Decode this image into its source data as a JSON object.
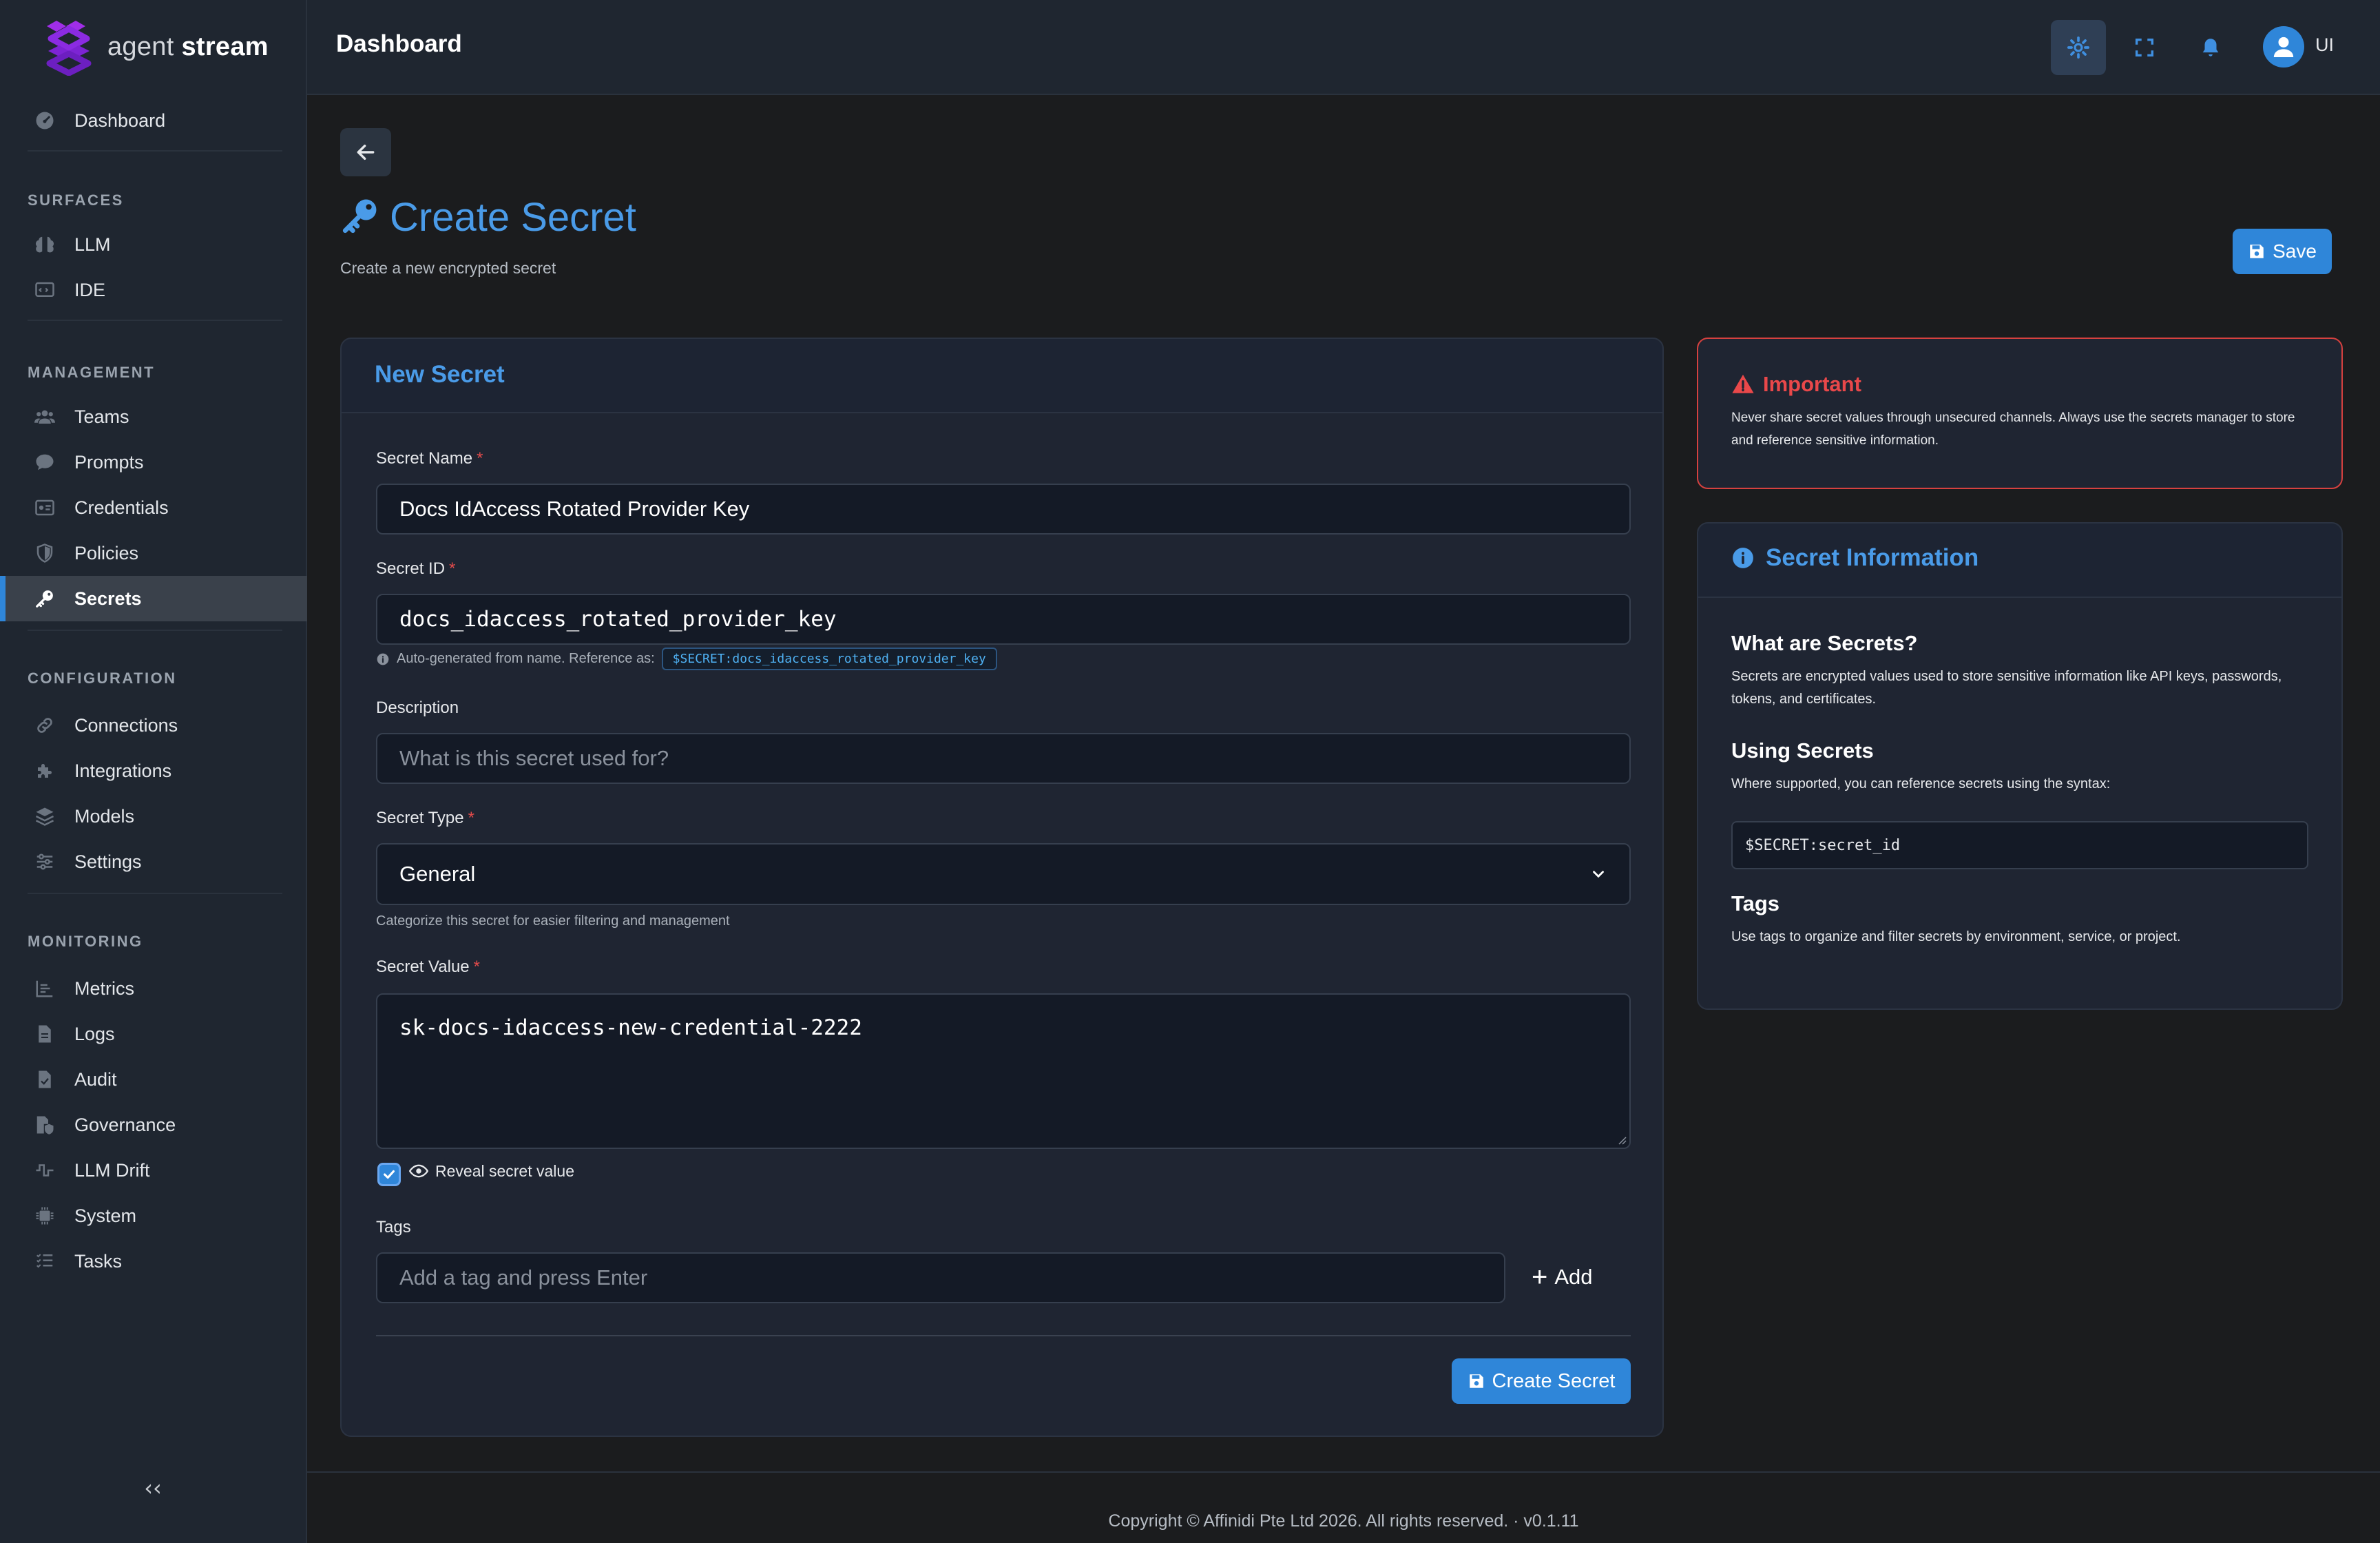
{
  "brand": {
    "name_part1": "agent",
    "name_part2": "stream"
  },
  "sidebar": {
    "dashboard": "Dashboard",
    "sections": {
      "surfaces": "SURFACES",
      "management": "MANAGEMENT",
      "configuration": "CONFIGURATION",
      "monitoring": "MONITORING"
    },
    "surfaces": [
      {
        "label": "LLM",
        "icon": "brain-icon"
      },
      {
        "label": "IDE",
        "icon": "code-window-icon"
      }
    ],
    "management": [
      {
        "label": "Teams",
        "icon": "users-icon"
      },
      {
        "label": "Prompts",
        "icon": "chat-icon"
      },
      {
        "label": "Credentials",
        "icon": "id-card-icon"
      },
      {
        "label": "Policies",
        "icon": "shield-icon"
      },
      {
        "label": "Secrets",
        "icon": "key-icon",
        "active": true
      }
    ],
    "configuration": [
      {
        "label": "Connections",
        "icon": "link-icon"
      },
      {
        "label": "Integrations",
        "icon": "puzzle-icon"
      },
      {
        "label": "Models",
        "icon": "layers-icon"
      },
      {
        "label": "Settings",
        "icon": "sliders-icon"
      }
    ],
    "monitoring": [
      {
        "label": "Metrics",
        "icon": "chart-icon"
      },
      {
        "label": "Logs",
        "icon": "file-icon"
      },
      {
        "label": "Audit",
        "icon": "file-check-icon"
      },
      {
        "label": "Governance",
        "icon": "file-shield-icon"
      },
      {
        "label": "LLM Drift",
        "icon": "wave-icon"
      },
      {
        "label": "System",
        "icon": "chip-icon"
      },
      {
        "label": "Tasks",
        "icon": "list-check-icon"
      }
    ],
    "collapse_label": "‹‹"
  },
  "topbar": {
    "title": "Dashboard",
    "user_initials": "UI"
  },
  "page": {
    "title": "Create Secret",
    "subtitle": "Create a new encrypted secret",
    "save_label": "Save"
  },
  "form": {
    "card_title": "New Secret",
    "name_label": "Secret Name",
    "name_value": "Docs IdAccess Rotated Provider Key",
    "id_label": "Secret ID",
    "id_value": "docs_idaccess_rotated_provider_key",
    "id_hint": "Auto-generated from name. Reference as:",
    "id_reference": "$SECRET:docs_idaccess_rotated_provider_key",
    "description_label": "Description",
    "description_placeholder": "What is this secret used for?",
    "type_label": "Secret Type",
    "type_value": "General",
    "type_hint": "Categorize this secret for easier filtering and management",
    "value_label": "Secret Value",
    "value_text": "sk-docs-idaccess-new-credential-2222",
    "reveal_label": "Reveal secret value",
    "reveal_checked": true,
    "tags_label": "Tags",
    "tags_placeholder": "Add a tag and press Enter",
    "add_label": "Add",
    "required_mark": "*",
    "create_label": "Create Secret"
  },
  "important": {
    "title": "Important",
    "text": "Never share secret values through unsecured channels. Always use the secrets manager to store and reference sensitive information."
  },
  "info": {
    "title": "Secret Information",
    "what_heading": "What are Secrets?",
    "what_text": "Secrets are encrypted values used to store sensitive information like API keys, passwords, tokens, and certificates.",
    "using_heading": "Using Secrets",
    "using_text": "Where supported, you can reference secrets using the syntax:",
    "syntax": "$SECRET:secret_id",
    "tags_heading": "Tags",
    "tags_text": "Use tags to organize and filter secrets by environment, service, or project."
  },
  "footer": {
    "copyright": "Copyright © Affinidi Pte Ltd 2026. All rights reserved. · v0.1.11"
  },
  "colors": {
    "accent": "#2f86d9",
    "title_blue": "#4a9be8",
    "danger": "#e9484a",
    "logo": "#8b2be2"
  }
}
